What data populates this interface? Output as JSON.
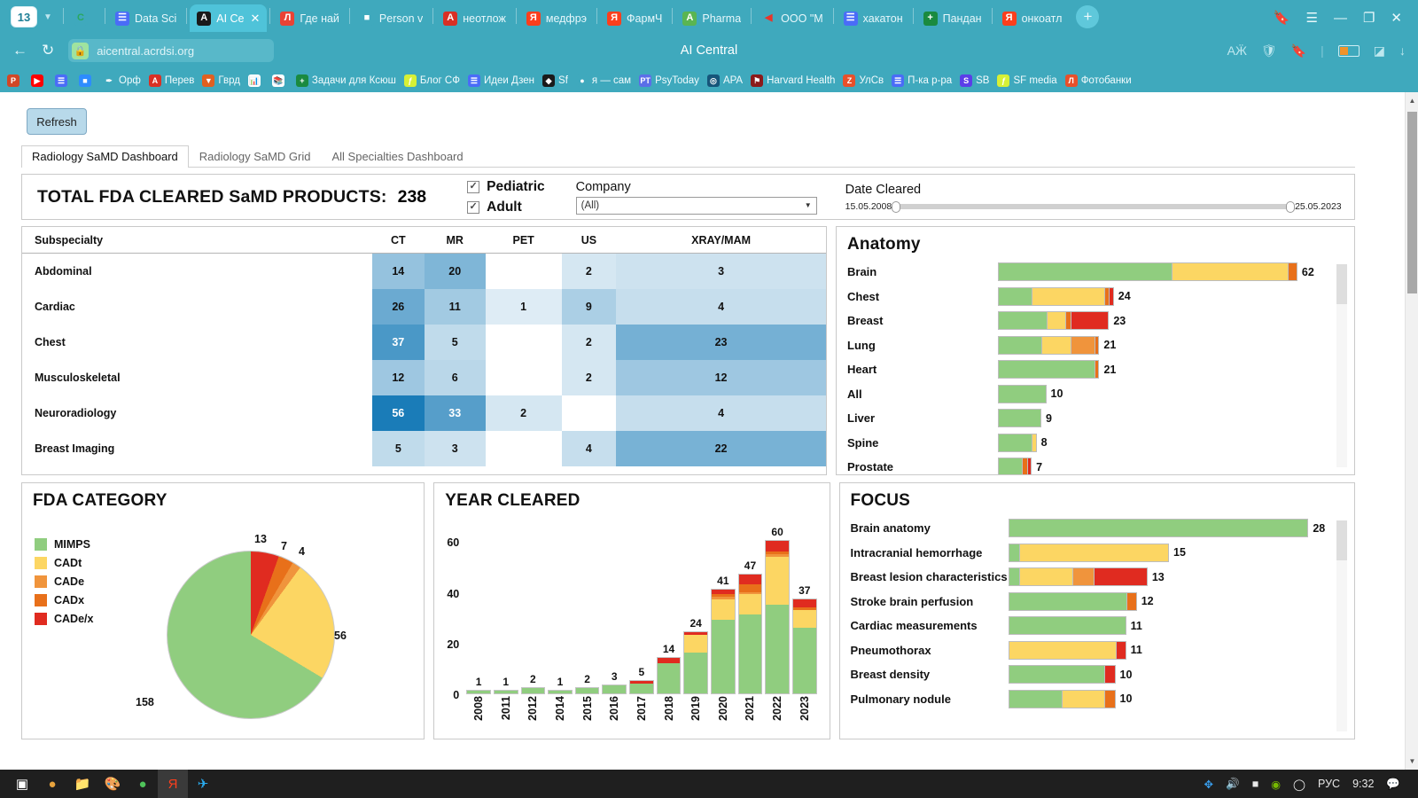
{
  "browser": {
    "session_badge": "13",
    "tabs": [
      {
        "label": "",
        "favicon": "chrome-icon",
        "fav_bg": "#3fa9bd",
        "fav_fg": "#2aa85f",
        "fav_text": "C",
        "active": false
      },
      {
        "label": "Data Sci",
        "favicon": "docs-icon",
        "fav_bg": "#4a6cf7",
        "fav_fg": "#ffffff",
        "fav_text": "☰",
        "active": false
      },
      {
        "label": "AI Ce",
        "favicon": "angular-icon",
        "fav_bg": "#1a1a1a",
        "fav_fg": "#ffffff",
        "fav_text": "A",
        "active": true
      },
      {
        "label": "Где най",
        "favicon": "letter-l-icon",
        "fav_bg": "#ea4335",
        "fav_fg": "#ffffff",
        "fav_text": "Л",
        "active": false
      },
      {
        "label": "Person v",
        "favicon": "person-icon",
        "fav_bg": "#3fa9bd",
        "fav_fg": "#ffffff",
        "fav_text": "■",
        "active": false
      },
      {
        "label": "неотлож",
        "favicon": "ab-icon",
        "fav_bg": "#d93025",
        "fav_fg": "#ffffff",
        "fav_text": "A",
        "active": false
      },
      {
        "label": "медфрэ",
        "favicon": "yandex-icon",
        "fav_bg": "#fc3f1d",
        "fav_fg": "#ffffff",
        "fav_text": "Я",
        "active": false
      },
      {
        "label": "ФармЧ",
        "favicon": "yandex-icon",
        "fav_bg": "#fc3f1d",
        "fav_fg": "#ffffff",
        "fav_text": "Я",
        "active": false
      },
      {
        "label": "Pharma",
        "favicon": "angular-green-icon",
        "fav_bg": "#5ab552",
        "fav_fg": "#ffffff",
        "fav_text": "A",
        "active": false
      },
      {
        "label": "ООО \"M",
        "favicon": "arrow-icon",
        "fav_bg": "#3fa9bd",
        "fav_fg": "#e8352a",
        "fav_text": "◀",
        "active": false
      },
      {
        "label": "хакатон",
        "favicon": "docs-icon",
        "fav_bg": "#4a6cf7",
        "fav_fg": "#ffffff",
        "fav_text": "☰",
        "active": false
      },
      {
        "label": "Пандан",
        "favicon": "plus-green-icon",
        "fav_bg": "#1a8a3f",
        "fav_fg": "#ffffff",
        "fav_text": "+",
        "active": false
      },
      {
        "label": "онкоатл",
        "favicon": "yandex-icon",
        "fav_bg": "#fc3f1d",
        "fav_fg": "#ffffff",
        "fav_text": "Я",
        "active": false
      }
    ],
    "new_tab_label": "+",
    "window_controls": [
      "collections-icon",
      "menu-icon",
      "minimize-icon",
      "restore-icon",
      "close-icon"
    ],
    "back_icon": "←",
    "reload_icon": "↻",
    "lock_icon": "🔒",
    "url": "aicentral.acrdsi.org",
    "page_title": "AI Central",
    "omni_icons": [
      "translate-icon",
      "shield-icon",
      "bookmark-icon",
      "battery-icon",
      "split-screen-icon",
      "downloads-icon"
    ],
    "bookmarks": [
      {
        "label": "",
        "bg": "#d24726",
        "text": "P"
      },
      {
        "label": "",
        "bg": "#ff0000",
        "text": "▶"
      },
      {
        "label": "",
        "bg": "#4a6cf7",
        "text": "☰"
      },
      {
        "label": "",
        "bg": "#2d8cff",
        "text": "■"
      },
      {
        "label": "Орф",
        "bg": "#3fa9bd",
        "text": "✒"
      },
      {
        "label": "Перев",
        "bg": "#d93025",
        "text": "A"
      },
      {
        "label": "Гврд",
        "bg": "#e06020",
        "text": "▼"
      },
      {
        "label": "",
        "bg": "#ffffff",
        "text": "📊"
      },
      {
        "label": "",
        "bg": "#ffffff",
        "text": "📚"
      },
      {
        "label": "Задачи для Ксюш",
        "bg": "#1a8a3f",
        "text": "+"
      },
      {
        "label": "Блог СФ",
        "bg": "#d7f035",
        "text": "ƒ"
      },
      {
        "label": "Идеи Дзен",
        "bg": "#4a6cf7",
        "text": "☰"
      },
      {
        "label": "Sf",
        "bg": "#1a1a1a",
        "text": "◆"
      },
      {
        "label": "я — сам",
        "bg": "#3fa9bd",
        "text": "●"
      },
      {
        "label": "PsyToday",
        "bg": "#5b6ee8",
        "text": "PT"
      },
      {
        "label": "APA",
        "bg": "#16557a",
        "text": "◎"
      },
      {
        "label": "Harvard Health",
        "bg": "#8b1a1a",
        "text": "⚑"
      },
      {
        "label": "УлСв",
        "bg": "#e8502a",
        "text": "Z"
      },
      {
        "label": "П-ка р-ра",
        "bg": "#4a6cf7",
        "text": "☰"
      },
      {
        "label": "SB",
        "bg": "#5b3ee8",
        "text": "S"
      },
      {
        "label": "SF media",
        "bg": "#d7f035",
        "text": "ƒ"
      },
      {
        "label": "Фотобанки",
        "bg": "#e8502a",
        "text": "Л"
      }
    ]
  },
  "toolbar": {
    "refresh_label": "Refresh"
  },
  "view_tabs": [
    {
      "label": "Radiology SaMD Dashboard",
      "active": true
    },
    {
      "label": "Radiology SaMD Grid",
      "active": false
    },
    {
      "label": "All Specialties Dashboard",
      "active": false
    }
  ],
  "header": {
    "total_title": "TOTAL FDA CLEARED SaMD PRODUCTS:",
    "total_value": "238",
    "checkboxes": [
      {
        "label": "Pediatric",
        "checked": true,
        "mark": "✓"
      },
      {
        "label": "Adult",
        "checked": true,
        "mark": "✓"
      }
    ],
    "company": {
      "label": "Company",
      "value": "(All)",
      "arrow": "▼"
    },
    "date_cleared": {
      "label": "Date Cleared",
      "min": "15.05.2008",
      "max": "25.05.2023"
    }
  },
  "palette": {
    "green": "#90cd7f",
    "yellow": "#fcd663",
    "orange_light": "#f0943c",
    "orange_dark": "#e8701a",
    "red": "#e02b20",
    "heat_max": "#1a7cb8"
  },
  "chart_data": [
    {
      "type": "table",
      "title": "Subspecialty modality counts",
      "columns": [
        "Subspecialty",
        "CT",
        "MR",
        "PET",
        "US",
        "XRAY/MAM"
      ],
      "rows": [
        {
          "label": "Abdominal",
          "values": [
            14,
            20,
            null,
            2,
            3
          ]
        },
        {
          "label": "Cardiac",
          "values": [
            26,
            11,
            1,
            9,
            4
          ]
        },
        {
          "label": "Chest",
          "values": [
            37,
            5,
            null,
            2,
            23
          ]
        },
        {
          "label": "Musculoskeletal",
          "values": [
            12,
            6,
            null,
            2,
            12
          ]
        },
        {
          "label": "Neuroradiology",
          "values": [
            56,
            33,
            2,
            null,
            4
          ]
        },
        {
          "label": "Breast Imaging",
          "values": [
            5,
            3,
            null,
            4,
            22
          ]
        }
      ]
    },
    {
      "type": "bar",
      "orientation": "horizontal",
      "title": "Anatomy",
      "stacked": true,
      "series_names": [
        "MIMPS",
        "CADt",
        "CADe",
        "CADx",
        "CADe/x"
      ],
      "categories": [
        "Brain",
        "Chest",
        "Breast",
        "Lung",
        "Heart",
        "All",
        "Liver",
        "Spine",
        "Prostate"
      ],
      "totals": [
        62,
        24,
        23,
        21,
        21,
        10,
        9,
        8,
        7
      ],
      "stacks": [
        [
          36,
          24,
          0,
          2,
          0
        ],
        [
          7,
          15,
          0,
          1,
          1
        ],
        [
          10,
          4,
          0,
          1,
          8
        ],
        [
          9,
          6,
          5,
          1,
          0
        ],
        [
          20,
          0,
          0,
          1,
          0
        ],
        [
          10,
          0,
          0,
          0,
          0
        ],
        [
          9,
          0,
          0,
          0,
          0
        ],
        [
          7,
          1,
          0,
          0,
          0
        ],
        [
          5,
          0,
          0,
          1,
          1
        ]
      ]
    },
    {
      "type": "pie",
      "title": "FDA CATEGORY",
      "labels": [
        "MIMPS",
        "CADt",
        "CADe",
        "CADx",
        "CADe/x"
      ],
      "values": [
        158,
        56,
        4,
        7,
        13
      ],
      "colors": [
        "#90cd7f",
        "#fcd663",
        "#f0943c",
        "#e8701a",
        "#e02b20"
      ],
      "legend_position": "left"
    },
    {
      "type": "bar",
      "orientation": "vertical",
      "stacked": true,
      "title": "YEAR CLEARED",
      "categories": [
        "2008",
        "2011",
        "2012",
        "2014",
        "2015",
        "2016",
        "2017",
        "2018",
        "2019",
        "2020",
        "2021",
        "2022",
        "2023"
      ],
      "totals": [
        1,
        1,
        2,
        1,
        2,
        3,
        5,
        14,
        24,
        41,
        47,
        60,
        37
      ],
      "series_names": [
        "MIMPS",
        "CADt",
        "CADe",
        "CADx",
        "CADe/x"
      ],
      "stacks": [
        [
          1,
          0,
          0,
          0,
          0
        ],
        [
          1,
          0,
          0,
          0,
          0
        ],
        [
          2,
          0,
          0,
          0,
          0
        ],
        [
          1,
          0,
          0,
          0,
          0
        ],
        [
          2,
          0,
          0,
          0,
          0
        ],
        [
          3,
          0,
          0,
          0,
          0
        ],
        [
          4,
          0,
          0,
          0,
          1
        ],
        [
          12,
          0,
          0,
          0,
          2
        ],
        [
          16,
          7,
          0,
          0,
          1
        ],
        [
          29,
          8,
          1,
          1,
          2
        ],
        [
          31,
          8,
          1,
          3,
          4
        ],
        [
          35,
          19,
          1,
          1,
          4
        ],
        [
          26,
          7,
          0,
          1,
          3
        ]
      ],
      "ylim": [
        0,
        65
      ],
      "yticks": [
        0,
        20,
        40,
        60
      ]
    },
    {
      "type": "bar",
      "orientation": "horizontal",
      "stacked": true,
      "title": "FOCUS",
      "series_names": [
        "MIMPS",
        "CADt",
        "CADe",
        "CADx",
        "CADe/x"
      ],
      "categories": [
        "Brain anatomy",
        "Intracranial hemorrhage",
        "Breast lesion characteristics",
        "Stroke brain perfusion",
        "Cardiac measurements",
        "Pneumothorax",
        "Breast density",
        "Pulmonary nodule"
      ],
      "totals": [
        28,
        15,
        13,
        12,
        11,
        11,
        10,
        10
      ],
      "stacks": [
        [
          28,
          0,
          0,
          0,
          0
        ],
        [
          1,
          14,
          0,
          0,
          0
        ],
        [
          1,
          5,
          2,
          0,
          5
        ],
        [
          11,
          0,
          0,
          1,
          0
        ],
        [
          11,
          0,
          0,
          0,
          0
        ],
        [
          0,
          10,
          0,
          0,
          1
        ],
        [
          9,
          0,
          0,
          0,
          1
        ],
        [
          5,
          4,
          0,
          1,
          0
        ]
      ]
    }
  ],
  "taskbar": {
    "start_icon": "windows-icon",
    "apps": [
      "chrome-icon",
      "file-explorer-icon",
      "paint-icon",
      "chrome-icon",
      "yandex-browser-icon",
      "telegram-icon"
    ],
    "tray": {
      "icons": [
        "bluetooth-icon",
        "volume-icon",
        "battery-icon",
        "nvidia-icon",
        "wifi-icon"
      ],
      "language": "РУС",
      "clock": "9:32",
      "notifications_icon": "notification-icon"
    }
  }
}
